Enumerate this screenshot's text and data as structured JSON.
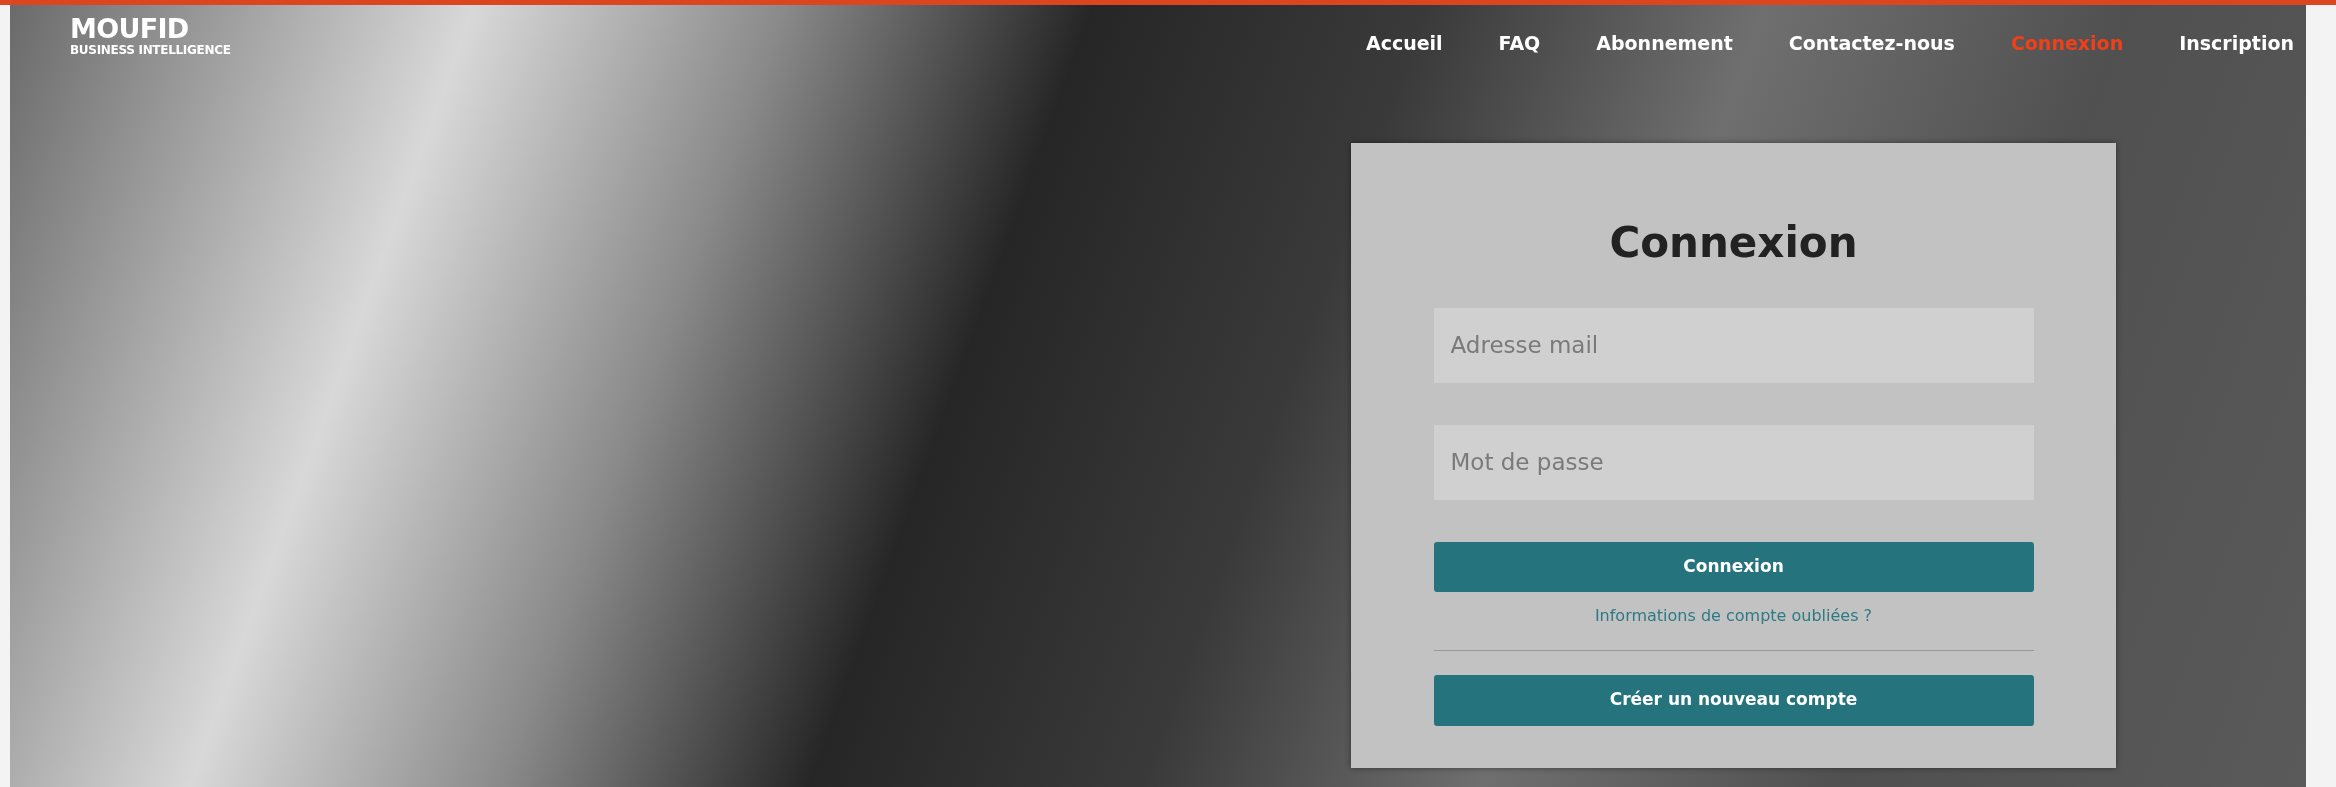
{
  "logo": {
    "name": "MOUFID",
    "tagline": "BUSINESS INTELLIGENCE"
  },
  "nav": [
    {
      "label": "Accueil",
      "selected": false
    },
    {
      "label": "FAQ",
      "selected": false
    },
    {
      "label": "Abonnement",
      "selected": false
    },
    {
      "label": "Contactez-nous",
      "selected": false
    },
    {
      "label": "Connexion",
      "selected": true
    },
    {
      "label": "Inscription",
      "selected": false
    }
  ],
  "login": {
    "title": "Connexion",
    "email": {
      "placeholder": "Adresse mail"
    },
    "password": {
      "placeholder": "Mot de passe"
    },
    "submit": "Connexion",
    "forgot_link": "Informations de compte oubliées ?",
    "create_account": "Créer un nouveau compte"
  }
}
